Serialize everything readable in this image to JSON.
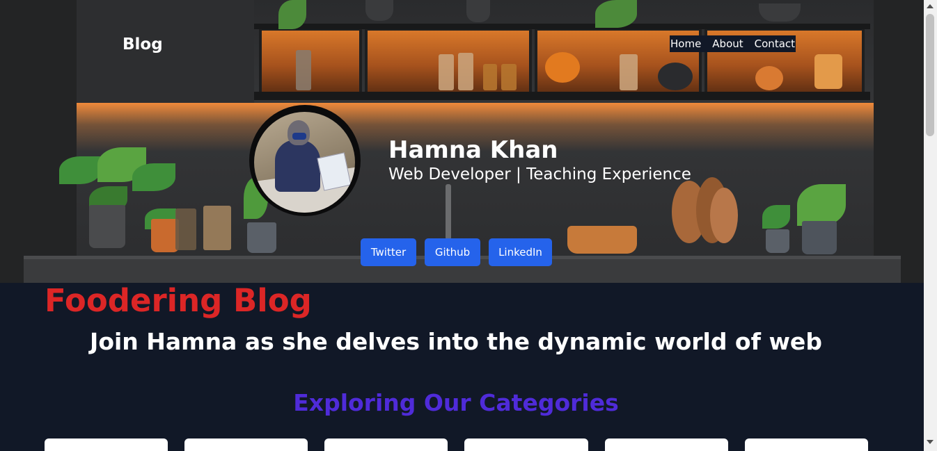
{
  "header": {
    "brand": "Blog",
    "nav": [
      "Home",
      "About",
      "Contact"
    ]
  },
  "profile": {
    "name": "Hamna Khan",
    "title": "Web Developer | Teaching Experience",
    "social": [
      "Twitter",
      "Github",
      "LinkedIn"
    ]
  },
  "main": {
    "blog_title": "Foodering Blog",
    "tagline": "Join Hamna as she delves into the dynamic world of web",
    "categories_heading": "Exploring Our Categories"
  },
  "colors": {
    "accent_red": "#dc2626",
    "accent_purple": "#4f2bd9",
    "button_blue": "#2563eb",
    "background": "#111827"
  }
}
